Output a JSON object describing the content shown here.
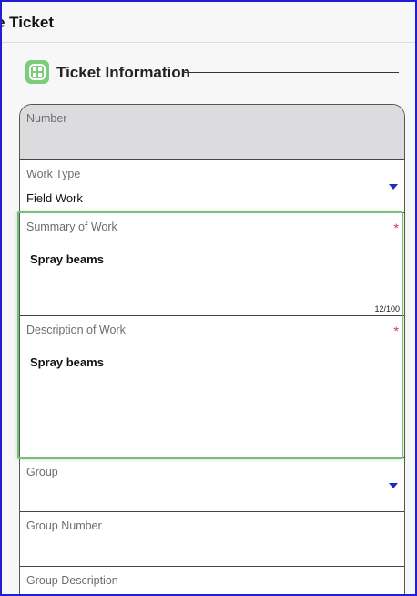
{
  "header": {
    "title": "e Ticket"
  },
  "section": {
    "title": "Ticket Information",
    "icon": "grid-icon"
  },
  "fields": {
    "number": {
      "label": "Number",
      "value": ""
    },
    "work_type": {
      "label": "Work Type",
      "value": "Field Work"
    },
    "summary": {
      "label": "Summary of Work",
      "value": "Spray beams",
      "required_marker": "*",
      "counter": "12/100"
    },
    "description": {
      "label": "Description of Work",
      "value": "Spray beams",
      "required_marker": "*"
    },
    "group": {
      "label": "Group",
      "value": ""
    },
    "group_number": {
      "label": "Group Number",
      "value": ""
    },
    "group_description": {
      "label": "Group Description",
      "value": ""
    }
  },
  "colors": {
    "accent": "#1b2bc4",
    "required": "#d0306f",
    "highlight": "#78c07a",
    "icon_bg": "#7ccc7c"
  }
}
